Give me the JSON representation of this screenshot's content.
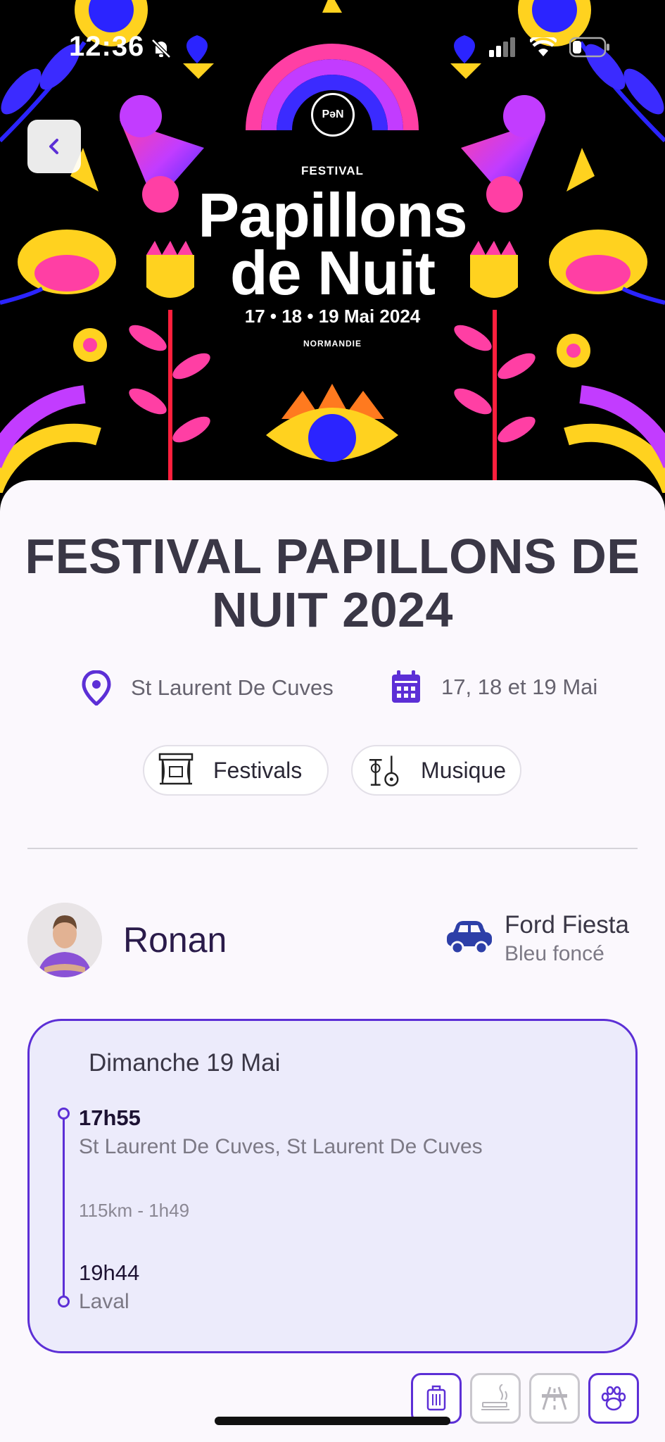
{
  "status_bar": {
    "time": "12:36"
  },
  "poster": {
    "logo": "PəN",
    "festival_label": "FESTIVAL",
    "title_line1": "Papillons",
    "title_line2": "de Nuit",
    "dates": "17 • 18 • 19 Mai 2024",
    "region": "NORMANDIE"
  },
  "event": {
    "title": "FESTIVAL PAPILLONS DE NUIT 2024",
    "location": "St Laurent De Cuves",
    "dates": "17, 18 et 19 Mai",
    "categories": [
      {
        "label": "Festivals",
        "icon": "stage-icon"
      },
      {
        "label": "Musique",
        "icon": "instruments-icon"
      }
    ]
  },
  "driver": {
    "name": "Ronan",
    "car_model": "Ford Fiesta",
    "car_color": "Bleu foncé"
  },
  "trip": {
    "day": "Dimanche 19 Mai",
    "departure_time": "17h55",
    "departure_place": "St Laurent De Cuves, St Laurent De Cuves",
    "distance_duration": "115km - 1h49",
    "arrival_time": "19h44",
    "arrival_place": "Laval"
  },
  "amenities": [
    {
      "icon": "luggage-icon",
      "active": true
    },
    {
      "icon": "no-smoking-icon",
      "active": false
    },
    {
      "icon": "highway-icon",
      "active": false
    },
    {
      "icon": "pet-paw-icon",
      "active": true
    }
  ],
  "colors": {
    "accent": "#5c2fd6",
    "title": "#3a3746",
    "card_bg": "#ecebfb"
  }
}
